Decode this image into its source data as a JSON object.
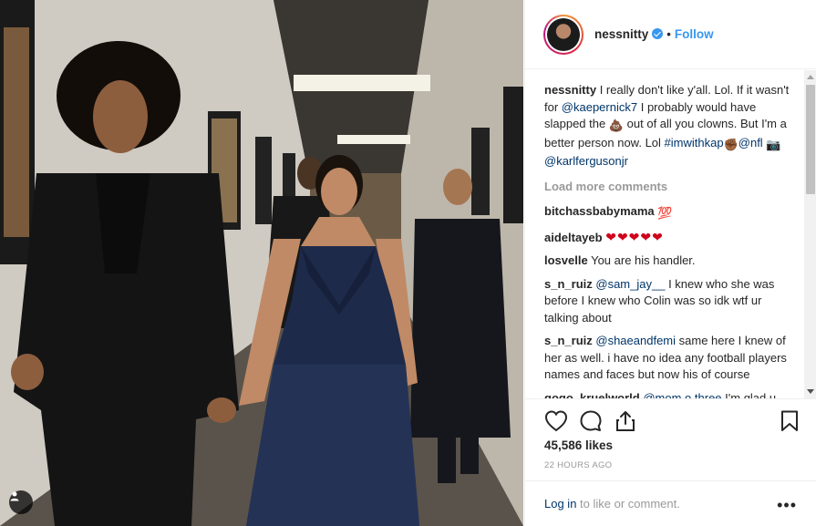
{
  "post": {
    "username": "nessnitty",
    "follow_label": "Follow",
    "separator": "•",
    "caption": {
      "username": "nessnitty",
      "text_1": "I really don't like y'all. Lol. If it wasn't for",
      "mention_1": "@kaepernick7",
      "text_2": "I probably would have slapped the",
      "emoji_poop": "💩",
      "text_3": "out of all you clowns. But I'm a better person now. Lol",
      "hashtag": "#imwithkap",
      "emoji_fist": "✊🏾",
      "mention_2": "@nfl",
      "emoji_camera": "📷",
      "mention_3": "@karlfergusonjr"
    },
    "load_more": "Load more comments",
    "comments": [
      {
        "user": "bitchassbabymama",
        "text": "",
        "emoji": "💯"
      },
      {
        "user": "aideltayeb",
        "text": "",
        "emoji": "❤❤❤❤❤"
      },
      {
        "user": "losvelle",
        "text": "You are his handler.",
        "emoji": ""
      },
      {
        "user": "s_n_ruiz",
        "mention": "@sam_jay__",
        "text": "I knew who she was before I knew who Colin was so idk wtf ur talking about"
      },
      {
        "user": "s_n_ruiz",
        "mention": "@shaeandfemi",
        "text": "same here I knew of her as well. i have no idea any football players names and faces but now his of course"
      },
      {
        "user": "gogo_kruelworld",
        "mention": "@mom.o.three",
        "text": "I'm glad u that nosey to know so much lol"
      }
    ],
    "likes": "45,586 likes",
    "time": "22 HOURS AGO",
    "footer": {
      "login": "Log in",
      "rest": "to like or comment.",
      "more": "•••"
    }
  },
  "icons": {
    "like": "heart-outline-icon",
    "comment": "speech-bubble-icon",
    "share": "share-upload-icon",
    "save": "bookmark-icon",
    "tag": "user-tag-icon"
  },
  "colors": {
    "accent": "#3897f0",
    "link": "#003569",
    "muted": "#999999",
    "heart": "#d0021b"
  }
}
